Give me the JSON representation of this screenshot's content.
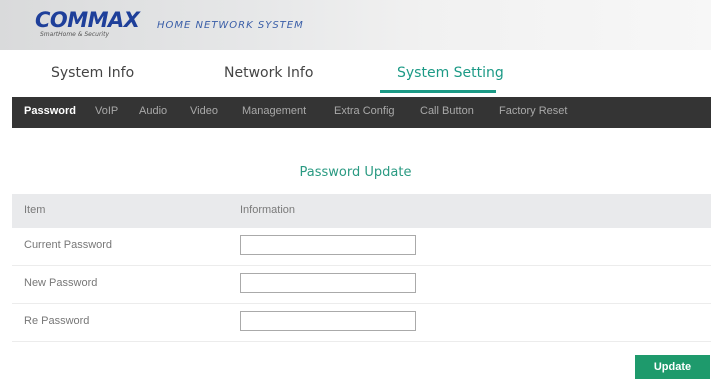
{
  "header": {
    "logo_text": "COMMAX",
    "logo_tagline": "SmartHome & Security",
    "system_name": "HOME NETWORK SYSTEM",
    "brand_color": "#1e3f9a"
  },
  "main_tabs": [
    {
      "label": "System Info",
      "active": false
    },
    {
      "label": "Network Info",
      "active": false
    },
    {
      "label": "System Setting",
      "active": true
    }
  ],
  "sub_nav": [
    {
      "label": "Password",
      "active": true
    },
    {
      "label": "VoIP",
      "active": false
    },
    {
      "label": "Audio",
      "active": false
    },
    {
      "label": "Video",
      "active": false
    },
    {
      "label": "Management",
      "active": false
    },
    {
      "label": "Extra Config",
      "active": false
    },
    {
      "label": "Call Button",
      "active": false
    },
    {
      "label": "Factory Reset",
      "active": false
    }
  ],
  "content": {
    "title": "Password Update",
    "table": {
      "headers": [
        "Item",
        "Information"
      ],
      "rows": [
        {
          "label": "Current Password",
          "value": ""
        },
        {
          "label": "New Password",
          "value": ""
        },
        {
          "label": "Re Password",
          "value": ""
        }
      ]
    },
    "update_label": "Update"
  },
  "colors": {
    "accent": "#1c9a86",
    "nav_bg": "#343434",
    "button_bg": "#1e9a6c"
  }
}
